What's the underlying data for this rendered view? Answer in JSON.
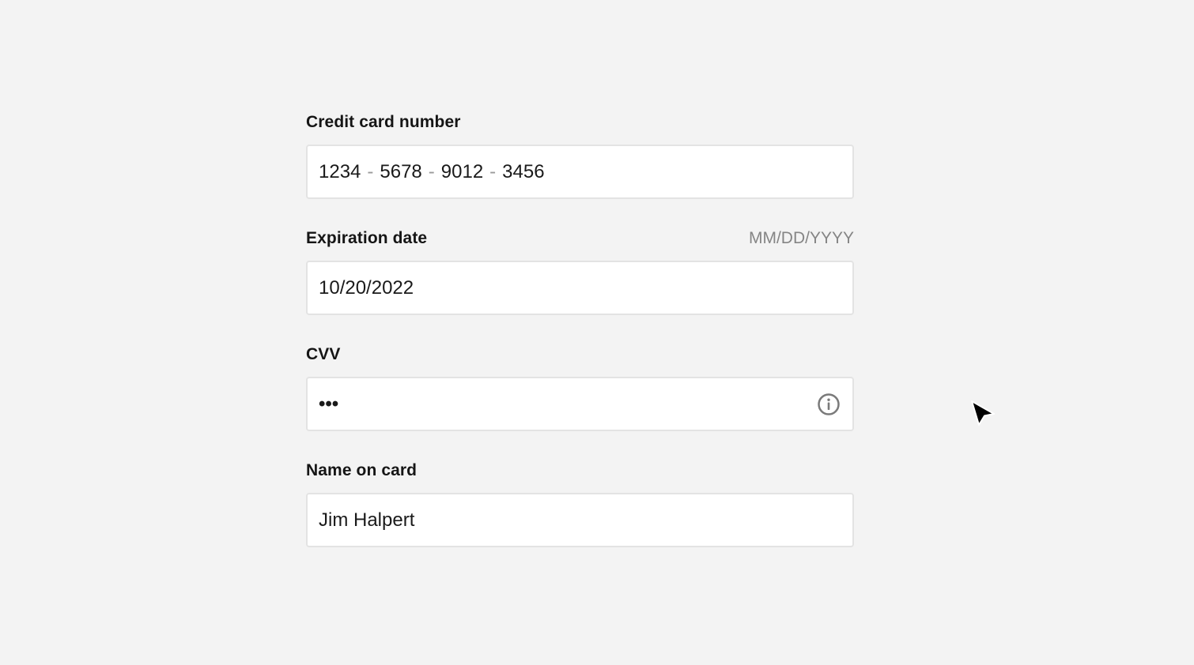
{
  "form": {
    "card_number": {
      "label": "Credit card number",
      "groups": [
        "1234",
        "5678",
        "9012",
        "3456"
      ],
      "separator": "-"
    },
    "expiration": {
      "label": "Expiration date",
      "hint": "MM/DD/YYYY",
      "value": "10/20/2022"
    },
    "cvv": {
      "label": "CVV",
      "value": "•••",
      "icon": "info-icon"
    },
    "name": {
      "label": "Name on card",
      "value": "Jim Halpert"
    }
  },
  "colors": {
    "background": "#f3f3f3",
    "input_background": "#ffffff",
    "input_border": "#e3e3e3",
    "hint": "#858585"
  }
}
